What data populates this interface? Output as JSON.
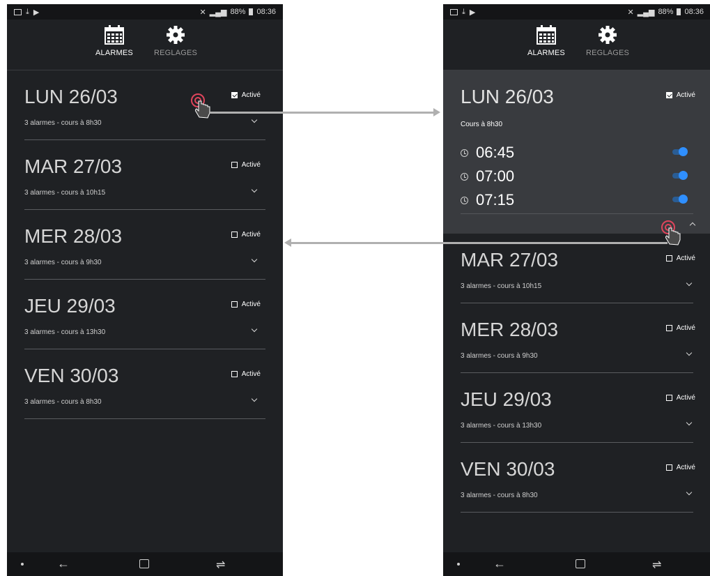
{
  "status_bar": {
    "battery": "88%",
    "time": "08:36"
  },
  "nav": {
    "alarms_label": "ALARMES",
    "settings_label": "REGLAGES"
  },
  "toggle_label": "Activé",
  "left_days": [
    {
      "title": "LUN 26/03",
      "subtitle": "3 alarmes - cours à 8h30",
      "enabled": true
    },
    {
      "title": "MAR 27/03",
      "subtitle": "3 alarmes - cours à 10h15",
      "enabled": false
    },
    {
      "title": "MER 28/03",
      "subtitle": "3 alarmes - cours à 9h30",
      "enabled": false
    },
    {
      "title": "JEU 29/03",
      "subtitle": "3 alarmes - cours à 13h30",
      "enabled": false
    },
    {
      "title": "VEN 30/03",
      "subtitle": "3 alarmes - cours à 8h30",
      "enabled": false
    }
  ],
  "expanded_day": {
    "title": "LUN 26/03",
    "course": "Cours à 8h30",
    "enabled": true,
    "alarms": [
      {
        "time": "06:45",
        "on": true
      },
      {
        "time": "07:00",
        "on": true
      },
      {
        "time": "07:15",
        "on": true
      }
    ]
  },
  "right_days": [
    {
      "title": "MAR 27/03",
      "subtitle": "3 alarmes - cours à 10h15",
      "enabled": false
    },
    {
      "title": "MER 28/03",
      "subtitle": "3 alarmes - cours à 9h30",
      "enabled": false
    },
    {
      "title": "JEU 29/03",
      "subtitle": "3 alarmes - cours à 13h30",
      "enabled": false
    },
    {
      "title": "VEN 30/03",
      "subtitle": "3 alarmes - cours à 8h30",
      "enabled": false
    }
  ],
  "colors": {
    "background": "#1f2124",
    "expanded_panel": "#393b3f",
    "switch_accent": "#2f8fff",
    "tap_indicator": "#e0455c",
    "arrow": "#b0b0b0"
  }
}
